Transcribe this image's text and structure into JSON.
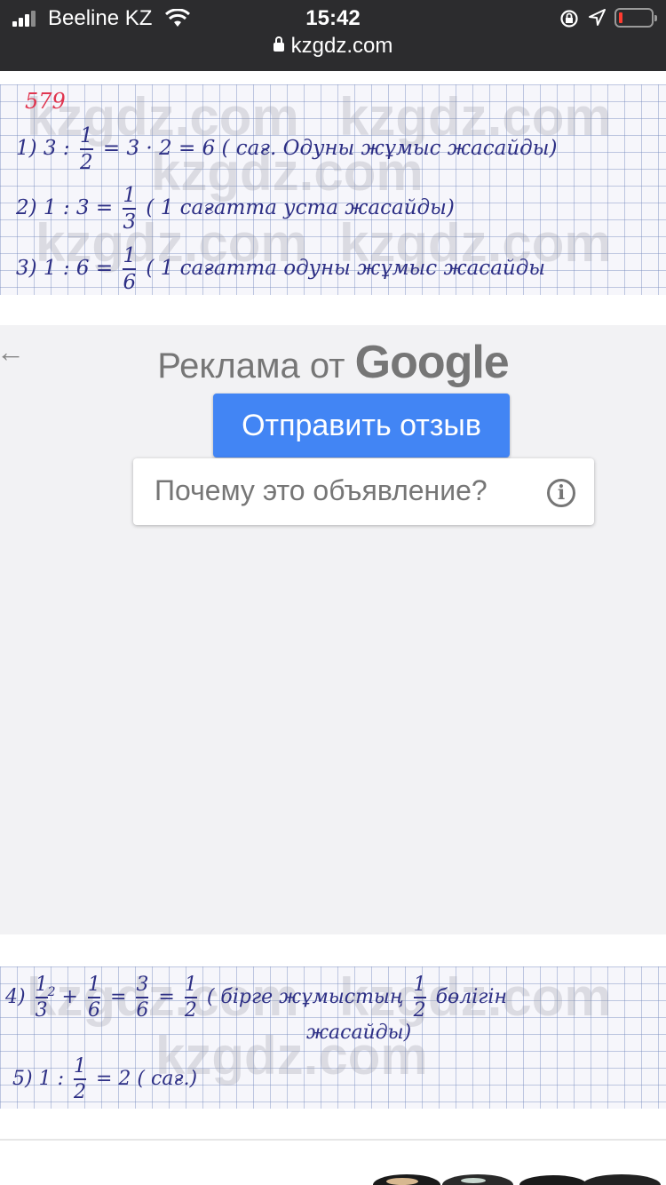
{
  "status_bar": {
    "carrier": "Beeline KZ",
    "time": "15:42",
    "battery_color": "#ff3b30"
  },
  "browser": {
    "url": "kzgdz.com"
  },
  "solution_top": {
    "problem_number": "579",
    "watermark": "kzgdz.com",
    "line1": {
      "num": "1)",
      "pre": "3 :",
      "frac_num": "1",
      "frac_den": "2",
      "post": "= 3 · 2 = 6 ( сағ. Одуны жұмыс жасайды)"
    },
    "line2": {
      "num": "2)",
      "pre": "1 : 3 =",
      "frac_num": "1",
      "frac_den": "3",
      "post": "( 1 сағатта уста жасайды)"
    },
    "line3": {
      "num": "3)",
      "pre": "1 : 6 =",
      "frac_num": "1",
      "frac_den": "6",
      "post": "( 1 сағатта одуны жұмыс жасайды"
    }
  },
  "ad": {
    "title_prefix": "Реклама от",
    "title_brand": "Google",
    "feedback_button": "Отправить отзыв",
    "why_text": "Почему это объявление?",
    "info_symbol": "i",
    "back_symbol": "←"
  },
  "solution_bottom": {
    "watermark": "kzgdz.com",
    "line4": {
      "num": "4)",
      "sup": "2",
      "f1_num": "1",
      "f1_den": "3",
      "plus": "+",
      "f2_num": "1",
      "f2_den": "6",
      "eq": "=",
      "f3_num": "3",
      "f3_den": "6",
      "eq2": "=",
      "f4_num": "1",
      "f4_den": "2",
      "text": "( бірге жұмыстың",
      "f5_num": "1",
      "f5_den": "2",
      "text2": "бөлігін",
      "text3": "жасайды)"
    },
    "line5": {
      "num": "5)",
      "pre": "1 :",
      "frac_num": "1",
      "frac_den": "2",
      "post": "= 2 ( сағ.)"
    }
  }
}
